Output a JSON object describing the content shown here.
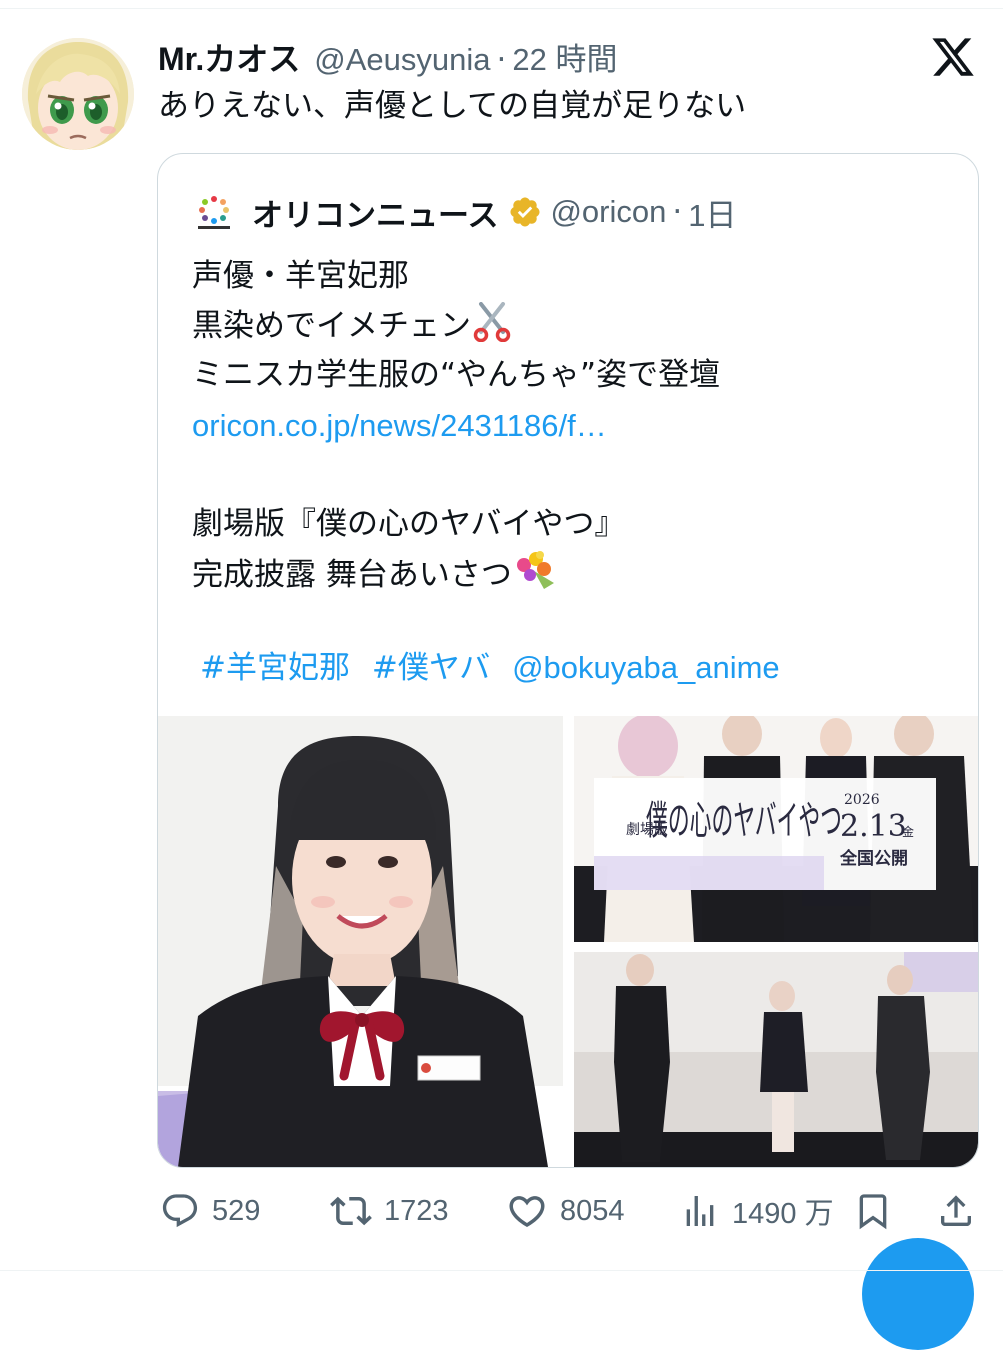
{
  "tweet": {
    "display_name": "Mr.カオス",
    "handle": "@Aeusyunia",
    "separator": "·",
    "time": "22 時間",
    "text": "ありえない、声優としての自覚が足りない"
  },
  "quote": {
    "name": "オリコンニュース",
    "handle": "@oricon",
    "separator": "·",
    "time": "1日",
    "lines": [
      "声優・羊宮妃那",
      "黒染めでイメチェン",
      "ミニスカ学生服の“やんちゃ”姿で登壇",
      "oricon.co.jp/news/2431186/f…",
      "",
      "劇場版『僕の心のヤバイやつ』",
      "完成披露 舞台あいさつ"
    ],
    "tags": [
      "#羊宮妃那",
      "#僕ヤバ",
      "@bokuyaba_anime"
    ],
    "media": {
      "main_image": "actress-photo",
      "top_right_image": "cast-with-poster-photo",
      "bottom_right_image": "stage-greeting-photo",
      "poster_title": "僕の心のヤバイやつ",
      "poster_label": "劇場版",
      "poster_year": "2026",
      "poster_date": "2.13",
      "poster_weekday": "金",
      "poster_release": "全国公開"
    }
  },
  "actions": {
    "replies": "529",
    "reposts": "1723",
    "likes": "8054",
    "views": "1490 万"
  },
  "colors": {
    "link": "#1d9bf0",
    "muted": "#536471",
    "text": "#0f1419",
    "border": "#cfd9de",
    "verified_gold": "#e8b528"
  },
  "icons": [
    "x-logo",
    "verified-badge",
    "reply-icon",
    "repost-icon",
    "like-icon",
    "views-icon",
    "bookmark-icon",
    "share-icon"
  ]
}
